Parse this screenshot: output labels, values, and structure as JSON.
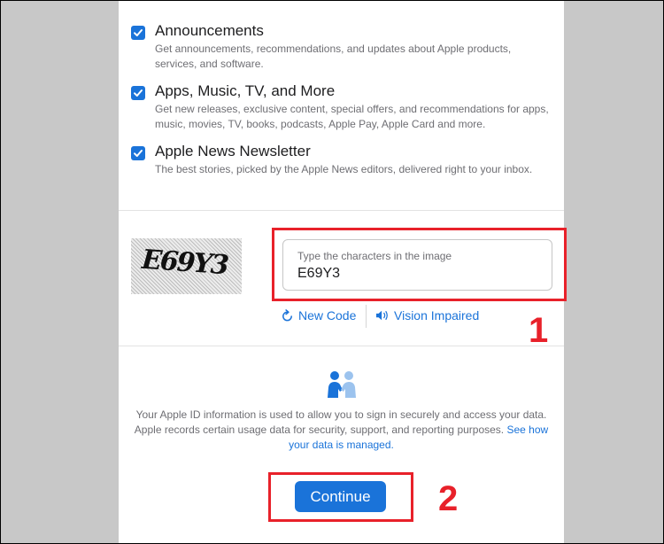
{
  "options": [
    {
      "title": "Announcements",
      "description": "Get announcements, recommendations, and updates about Apple products, services, and software.",
      "checked": true
    },
    {
      "title": "Apps, Music, TV, and More",
      "description": "Get new releases, exclusive content, special offers, and recommendations for apps, music, movies, TV, books, podcasts, Apple Pay, Apple Card and more.",
      "checked": true
    },
    {
      "title": "Apple News Newsletter",
      "description": "The best stories, picked by the Apple News editors, delivered right to your inbox.",
      "checked": true
    }
  ],
  "captcha": {
    "image_text": "E69Y3",
    "input_label": "Type the characters in the image",
    "input_value": "E69Y3",
    "new_code_label": "New Code",
    "vision_impaired_label": "Vision Impaired"
  },
  "privacy": {
    "text": "Your Apple ID information is used to allow you to sign in securely and access your data. Apple records certain usage data for security, support, and reporting purposes.",
    "link_text": "See how your data is managed."
  },
  "continue_label": "Continue",
  "annotations": {
    "step1": "1",
    "step2": "2",
    "highlight_color": "#e8212a"
  },
  "colors": {
    "accent": "#1a73d9",
    "background_side": "#c8c8c8",
    "panel": "#ffffff"
  },
  "icons": {
    "checkbox": "checkmark-icon",
    "refresh": "refresh-icon",
    "speaker": "speaker-icon",
    "people": "people-handshake-icon"
  }
}
